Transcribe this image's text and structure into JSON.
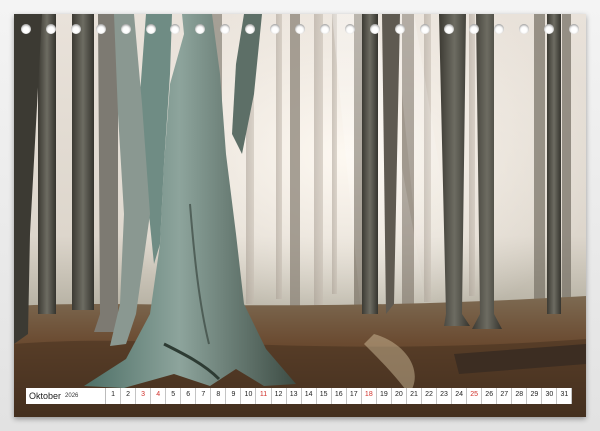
{
  "calendar": {
    "month": "Oktober",
    "year": "2026",
    "days": [
      {
        "n": "1",
        "red": false
      },
      {
        "n": "2",
        "red": false
      },
      {
        "n": "3",
        "red": true
      },
      {
        "n": "4",
        "red": true
      },
      {
        "n": "5",
        "red": false
      },
      {
        "n": "6",
        "red": false
      },
      {
        "n": "7",
        "red": false
      },
      {
        "n": "8",
        "red": false
      },
      {
        "n": "9",
        "red": false
      },
      {
        "n": "10",
        "red": false
      },
      {
        "n": "11",
        "red": true
      },
      {
        "n": "12",
        "red": false
      },
      {
        "n": "13",
        "red": false
      },
      {
        "n": "14",
        "red": false
      },
      {
        "n": "15",
        "red": false
      },
      {
        "n": "16",
        "red": false
      },
      {
        "n": "17",
        "red": false
      },
      {
        "n": "18",
        "red": true
      },
      {
        "n": "19",
        "red": false
      },
      {
        "n": "20",
        "red": false
      },
      {
        "n": "21",
        "red": false
      },
      {
        "n": "22",
        "red": false
      },
      {
        "n": "23",
        "red": false
      },
      {
        "n": "24",
        "red": false
      },
      {
        "n": "25",
        "red": true
      },
      {
        "n": "26",
        "red": false
      },
      {
        "n": "27",
        "red": false
      },
      {
        "n": "28",
        "red": false
      },
      {
        "n": "29",
        "red": false
      },
      {
        "n": "30",
        "red": false
      },
      {
        "n": "31",
        "red": false
      }
    ]
  },
  "binding": {
    "ring_count": 23
  },
  "colors": {
    "weekend_red": "#d0302a",
    "mist": "#f1ebe4",
    "forest_floor": "#6b4a2e"
  }
}
